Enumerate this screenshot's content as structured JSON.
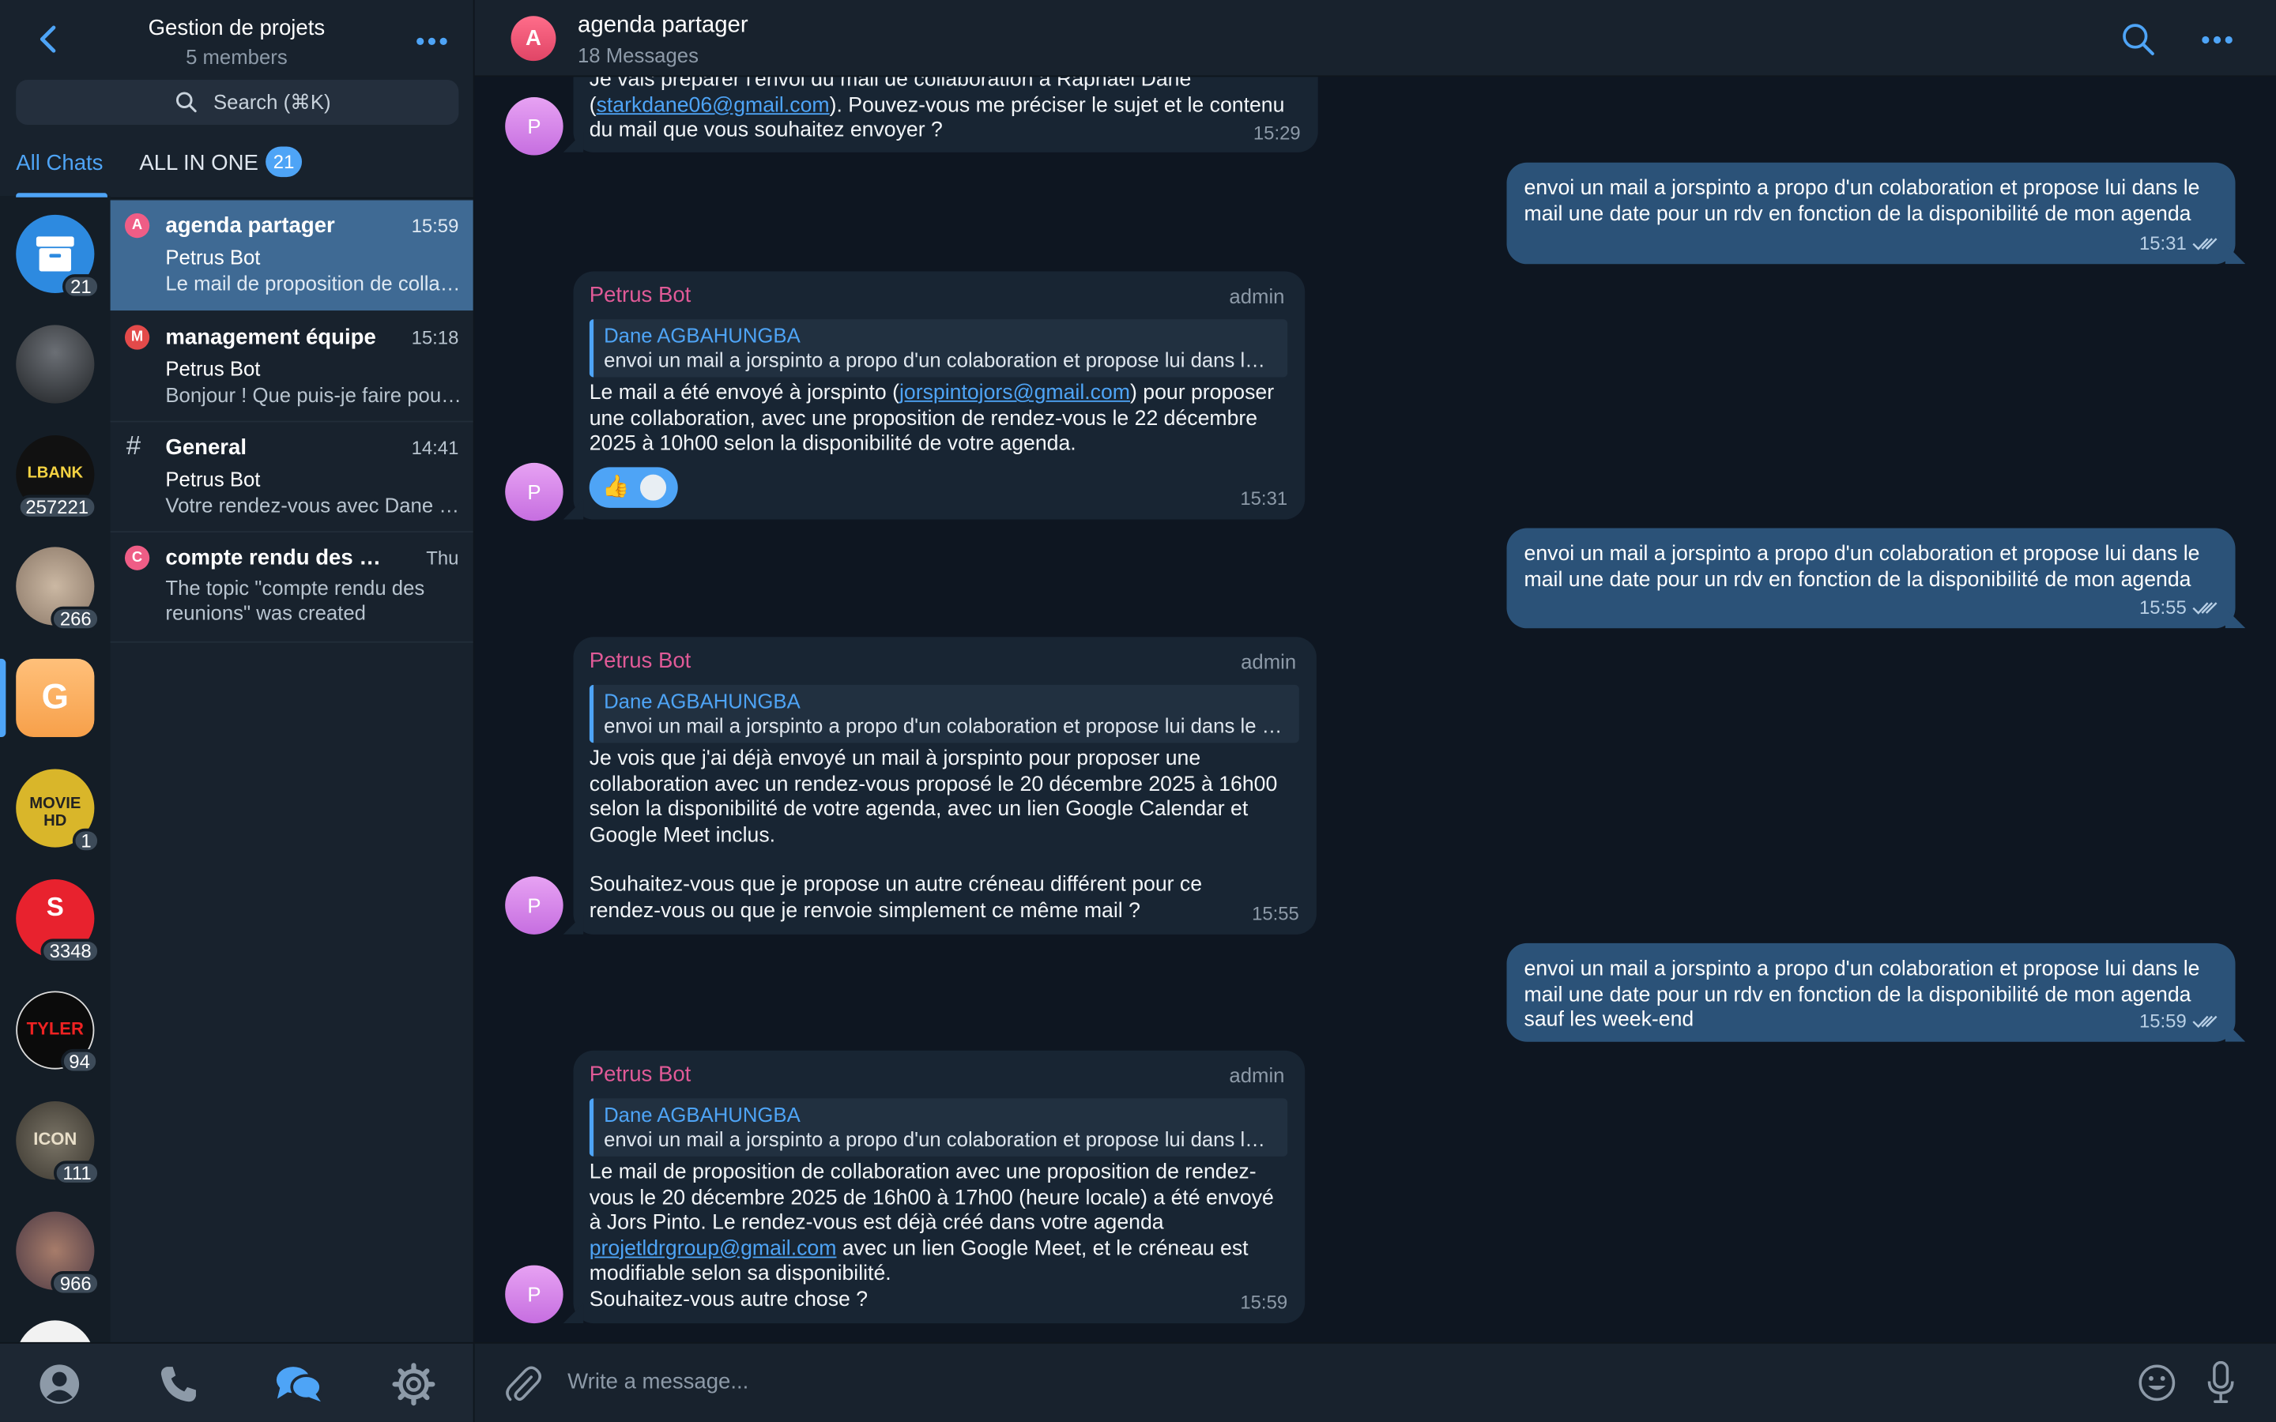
{
  "sidebar": {
    "group_title": "Gestion de projets",
    "group_subtitle": "5 members",
    "search_placeholder": "Search (⌘K)",
    "tabs": [
      {
        "label": "All Chats"
      },
      {
        "label": "ALL IN ONE",
        "badge": "21"
      }
    ],
    "chats": [
      {
        "avatar_letter": "A",
        "title": "agenda partager",
        "time": "15:59",
        "sender": "Petrus Bot",
        "preview": "Le mail de proposition de collaboration avec une proposition de rendez-vous",
        "selected": true
      },
      {
        "avatar_letter": "M",
        "title": "management équipe",
        "time": "15:18",
        "sender": "Petrus Bot",
        "preview": "Bonjour ! Que puis-je faire pour vous ?"
      },
      {
        "avatar_letter": "#",
        "title": "General",
        "time": "14:41",
        "sender": "Petrus Bot",
        "preview": "Votre rendez-vous avec Dane est confirmé"
      },
      {
        "avatar_letter": "C",
        "title": "compte rendu des reunions",
        "time": "Thu",
        "preview": "The topic \"compte rendu des reunions\" was created"
      }
    ]
  },
  "rail": {
    "items": [
      {
        "badge": "21",
        "icon": "archive-icon"
      },
      {
        "badge": ""
      },
      {
        "badge": "257221",
        "label": "LBANK"
      },
      {
        "badge": "266"
      },
      {
        "letter": "G",
        "active": true
      },
      {
        "badge": "1",
        "label": "MOVIE HD"
      },
      {
        "badge": "3348",
        "label": "S"
      },
      {
        "badge": "94",
        "label": "TYLER"
      },
      {
        "badge": "111",
        "label": "ICON"
      },
      {
        "badge": "966"
      }
    ]
  },
  "bottom_tabs": [
    "contacts-icon",
    "calls-icon",
    "chats-icon",
    "settings-icon"
  ],
  "header": {
    "avatar_letter": "A",
    "title": "agenda partager",
    "subtitle": "18 Messages"
  },
  "messages": {
    "m0": {
      "avatar_letter": "P",
      "line1": "Je vais préparer l'envoi du mail de collaboration à Raphaël Dane",
      "line2_pre": "(",
      "link": "starkdane06@gmail.com",
      "line2_post": "). Pouvez-vous me préciser le sujet et le contenu",
      "line3": "du mail que vous souhaitez envoyer ?",
      "time": "15:29"
    },
    "o1": {
      "text": "envoi un mail a jorspinto a propo d'un colaboration et propose lui dans le mail une date pour un rdv en fonction de la disponibilité de mon agenda",
      "time": "15:31"
    },
    "m1": {
      "avatar_letter": "P",
      "sender": "Petrus Bot",
      "role": "admin",
      "reply_name": "Dane AGBAHUNGBA",
      "reply_text": "envoi un mail a jorspinto a propo d'un colaboration et propose lui dans le mail une date",
      "pre": "Le mail a été envoyé à jorspinto (",
      "link": "jorspintojors@gmail.com",
      "post": ") pour proposer une collaboration, avec une proposition de rendez-vous le 22 décembre 2025 à 10h00 selon la disponibilité de votre agenda.",
      "reaction": "👍",
      "time": "15:31"
    },
    "o2": {
      "text": "envoi un mail a jorspinto a propo d'un colaboration et propose lui dans le mail une date pour un rdv en fonction de la disponibilité de mon agenda",
      "time": "15:55"
    },
    "m2": {
      "avatar_letter": "P",
      "sender": "Petrus Bot",
      "role": "admin",
      "reply_name": "Dane AGBAHUNGBA",
      "reply_text": "envoi un mail a jorspinto a propo d'un colaboration et propose lui dans le mail une date",
      "para1": "Je vois que j'ai déjà envoyé un mail à jorspinto pour proposer une collaboration avec un rendez-vous proposé le 20 décembre 2025 à 16h00 selon la disponibilité de votre agenda, avec un lien Google Calendar et Google Meet inclus.",
      "para2": "Souhaitez-vous que je propose un autre créneau différent pour ce rendez-vous ou que je renvoie simplement ce même mail ?",
      "time": "15:55"
    },
    "o3": {
      "text": "envoi un mail a jorspinto a propo d'un colaboration et propose lui dans le mail une date pour un rdv en fonction de la disponibilité de mon agenda sauf les week-end",
      "time": "15:59"
    },
    "m3": {
      "avatar_letter": "P",
      "sender": "Petrus Bot",
      "role": "admin",
      "reply_name": "Dane AGBAHUNGBA",
      "reply_text": "envoi un mail a jorspinto a propo d'un colaboration et propose lui dans le mail une date",
      "pre": "Le mail de proposition de collaboration avec une proposition de rendez-vous le 20 décembre 2025 de 16h00 à 17h00 (heure locale) a été envoyé à Jors Pinto. Le rendez-vous est déjà créé dans votre agenda ",
      "link": "projetldrgroup@gmail.com",
      "post": " avec un lien Google Meet, et le créneau est modifiable selon sa disponibilité.",
      "last": "Souhaitez-vous autre chose ?",
      "time": "15:59"
    }
  },
  "composer": {
    "placeholder": "Write a message..."
  },
  "colors": {
    "accent": "#4ea4f6",
    "incoming_bubble": "#182533",
    "outgoing_bubble": "#2b5278",
    "sender_name": "#e05a97",
    "background": "#0e1621"
  }
}
